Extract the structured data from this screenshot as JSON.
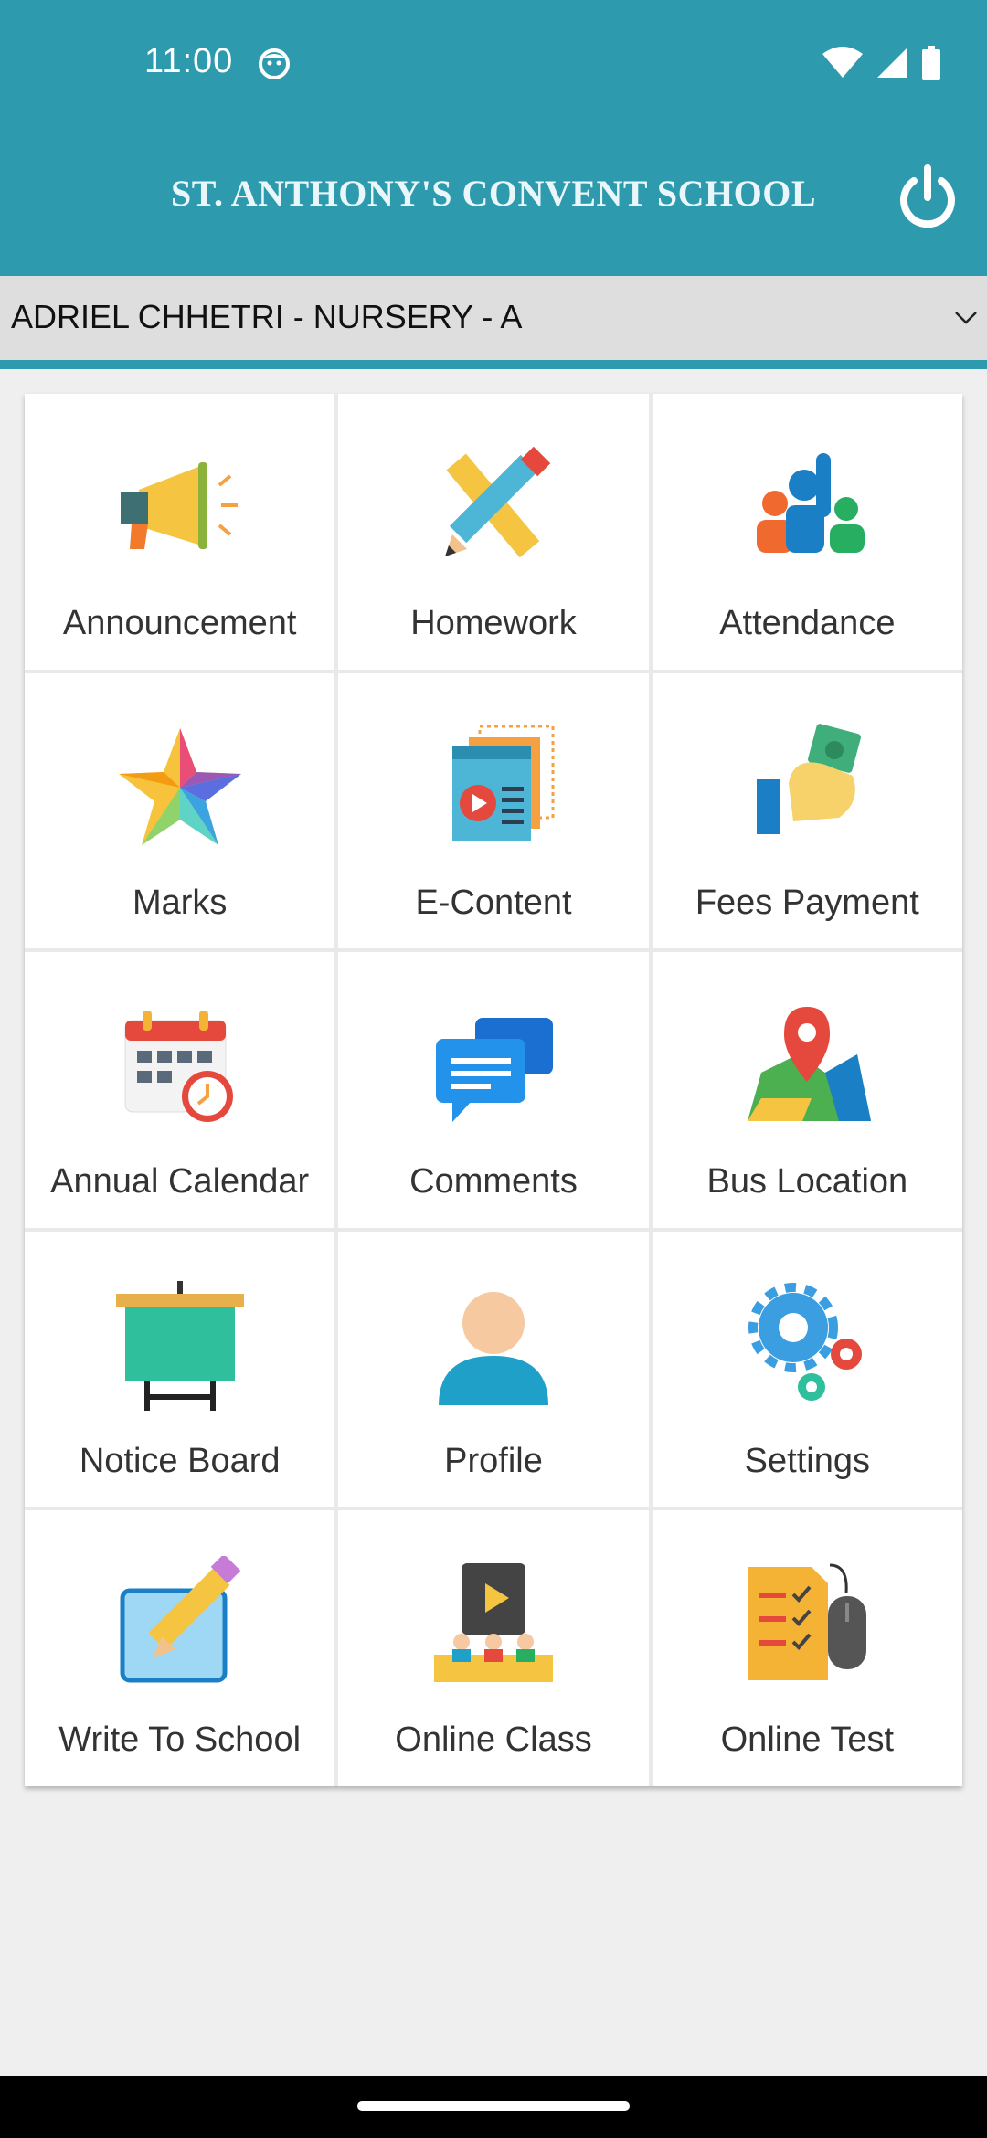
{
  "status_bar": {
    "time": "11:00"
  },
  "header": {
    "title": "ST. ANTHONY'S CONVENT SCHOOL"
  },
  "student_selector": {
    "selected": "ADRIEL CHHETRI - NURSERY - A"
  },
  "menu": [
    {
      "label": "Announcement",
      "icon": "megaphone-icon"
    },
    {
      "label": "Homework",
      "icon": "pencil-ruler-icon"
    },
    {
      "label": "Attendance",
      "icon": "raised-hand-group-icon"
    },
    {
      "label": "Marks",
      "icon": "star-icon"
    },
    {
      "label": "E-Content",
      "icon": "video-window-icon"
    },
    {
      "label": "Fees Payment",
      "icon": "hand-cash-icon"
    },
    {
      "label": "Annual Calendar",
      "icon": "calendar-clock-icon"
    },
    {
      "label": "Comments",
      "icon": "chat-bubbles-icon"
    },
    {
      "label": "Bus Location",
      "icon": "map-pin-icon"
    },
    {
      "label": "Notice Board",
      "icon": "easel-board-icon"
    },
    {
      "label": "Profile",
      "icon": "user-avatar-icon"
    },
    {
      "label": "Settings",
      "icon": "gears-icon"
    },
    {
      "label": "Write To School",
      "icon": "write-note-icon"
    },
    {
      "label": "Online Class",
      "icon": "online-class-icon"
    },
    {
      "label": "Online Test",
      "icon": "test-checklist-mouse-icon"
    }
  ],
  "colors": {
    "brand": "#2e9aae",
    "background": "#efefef"
  }
}
